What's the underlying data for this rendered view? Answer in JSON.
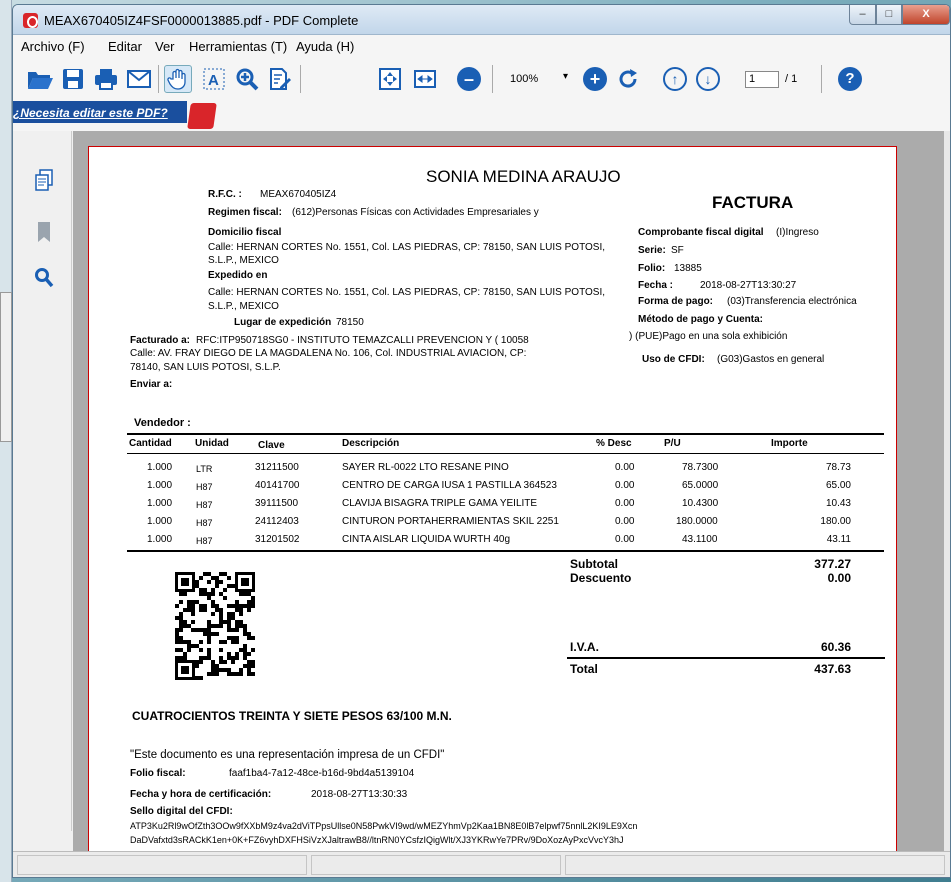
{
  "window": {
    "title": "MEAX670405IZ4FSF0000013885.pdf - PDF Complete",
    "controls": {
      "minimize": "–",
      "maximize": "□",
      "close": "X"
    }
  },
  "menu": [
    "Archivo (F)",
    "Editar",
    "Ver",
    "Herramientas (T)",
    "Ayuda (H)"
  ],
  "toolbar": {
    "zoom": "100%",
    "zoom_dropdown": "▾",
    "page_input": "1",
    "page_total": "/ 1"
  },
  "ad": {
    "link": "¿Necesita editar este PDF?"
  },
  "doc": {
    "issuer_name": "SONIA MEDINA ARAUJO",
    "rfc_label": "R.F.C. :",
    "rfc_value": "MEAX670405IZ4",
    "regimen_label": "Regimen fiscal:",
    "regimen_value": "(612)Personas Físicas con Actividades Empresariales y",
    "domicilio_label": "Domicilio fiscal",
    "domicilio_line1": "Calle: HERNAN CORTES No. 1551, Col. LAS PIEDRAS, CP: 78150, SAN LUIS POTOSI,",
    "domicilio_line2": "S.L.P., MEXICO",
    "expedido_label": "Expedido en",
    "expedido_line1": "Calle: HERNAN CORTES No. 1551, Col. LAS PIEDRAS, CP: 78150, SAN LUIS POTOSI,",
    "expedido_line2": "S.L.P., MEXICO",
    "lugar_label": "Lugar de expedición",
    "lugar_value": "78150",
    "facturado_label": "Facturado a:",
    "facturado_value": "RFC:ITP950718SG0      - INSTITUTO TEMAZCALLI PREVENCION Y  (          10058",
    "facturado_line2": "Calle: AV. FRAY DIEGO DE LA MAGDALENA No. 106, Col. INDUSTRIAL AVIACION, CP:",
    "facturado_line3": "78140, SAN LUIS POTOSI, S.L.P.",
    "enviar_label": "Enviar a:",
    "doc_type": "FACTURA",
    "comprobante_label": "Comprobante fiscal digital",
    "comprobante_value": "(I)Ingreso",
    "serie_label": "Serie:",
    "serie_value": "SF",
    "folio_label": "Folio:",
    "folio_value": "13885",
    "fecha_label": "Fecha :",
    "fecha_value": "2018-08-27T13:30:27",
    "forma_label": "Forma de pago:",
    "forma_value": "(03)Transferencia electrónica",
    "metodo_label": "Método de pago y Cuenta:",
    "metodo_value": ") (PUE)Pago en una sola exhibición",
    "uso_label": "Uso de CFDI:",
    "uso_value": "(G03)Gastos en general",
    "vendedor_label": "Vendedor :",
    "headers": {
      "cantidad": "Cantidad",
      "unidad": "Unidad",
      "clave": "Clave",
      "descripcion": "Descripción",
      "desc": "% Desc",
      "pu": "P/U",
      "importe": "Importe"
    },
    "items": [
      {
        "cantidad": "1.000",
        "unidad": "LTR",
        "clave": "31211500",
        "descripcion": "SAYER RL-0022 LTO RESANE PINO",
        "desc": "0.00",
        "pu": "78.7300",
        "importe": "78.73"
      },
      {
        "cantidad": "1.000",
        "unidad": "H87",
        "clave": "40141700",
        "descripcion": "CENTRO DE CARGA IUSA 1 PASTILLA 364523",
        "desc": "0.00",
        "pu": "65.0000",
        "importe": "65.00"
      },
      {
        "cantidad": "1.000",
        "unidad": "H87",
        "clave": "39111500",
        "descripcion": "CLAVIJA BISAGRA TRIPLE GAMA YEILITE",
        "desc": "0.00",
        "pu": "10.4300",
        "importe": "10.43"
      },
      {
        "cantidad": "1.000",
        "unidad": "H87",
        "clave": "24112403",
        "descripcion": "CINTURON PORTAHERRAMIENTAS SKIL 2251",
        "desc": "0.00",
        "pu": "180.0000",
        "importe": "180.00"
      },
      {
        "cantidad": "1.000",
        "unidad": "H87",
        "clave": "31201502",
        "descripcion": "CINTA AISLAR LIQUIDA WURTH 40g",
        "desc": "0.00",
        "pu": "43.1100",
        "importe": "43.11"
      }
    ],
    "subtotal_label": "Subtotal",
    "subtotal_value": "377.27",
    "descuento_label": "Descuento",
    "descuento_value": "0.00",
    "iva_label": "I.V.A.",
    "iva_value": "60.36",
    "total_label": "Total",
    "total_value": "437.63",
    "amount_words": "CUATROCIENTOS TREINTA Y SIETE PESOS 63/100 M.N.",
    "cfdi_note": "\"Este documento es una representación impresa de un CFDI\"",
    "folio_fiscal_label": "Folio fiscal:",
    "folio_fiscal_value": "faaf1ba4-7a12-48ce-b16d-9bd4a5139104",
    "certificacion_label": "Fecha y hora de certificación:",
    "certificacion_value": "2018-08-27T13:30:33",
    "sello_label": "Sello digital del CFDI:",
    "sello_line1": "ATP3Ku2Rl9wOfZth3OOw9fXXbM9z4va2dViTPpsUllse0N58PwkVI9wd/wMEZYhmVp2Kaa1BN8E0lB7elpwf75nnlL2KI9LE9Xcn",
    "sello_line2": "DaDVafxtd3sRACkK1en+0K+FZ6vyhDXFHSiVzXJaltrawB8//ltnRN0YCsfzIQigWlt/XJ3YKRwYe7PRv/9DoXozAyPxcVvcY3hJ"
  }
}
